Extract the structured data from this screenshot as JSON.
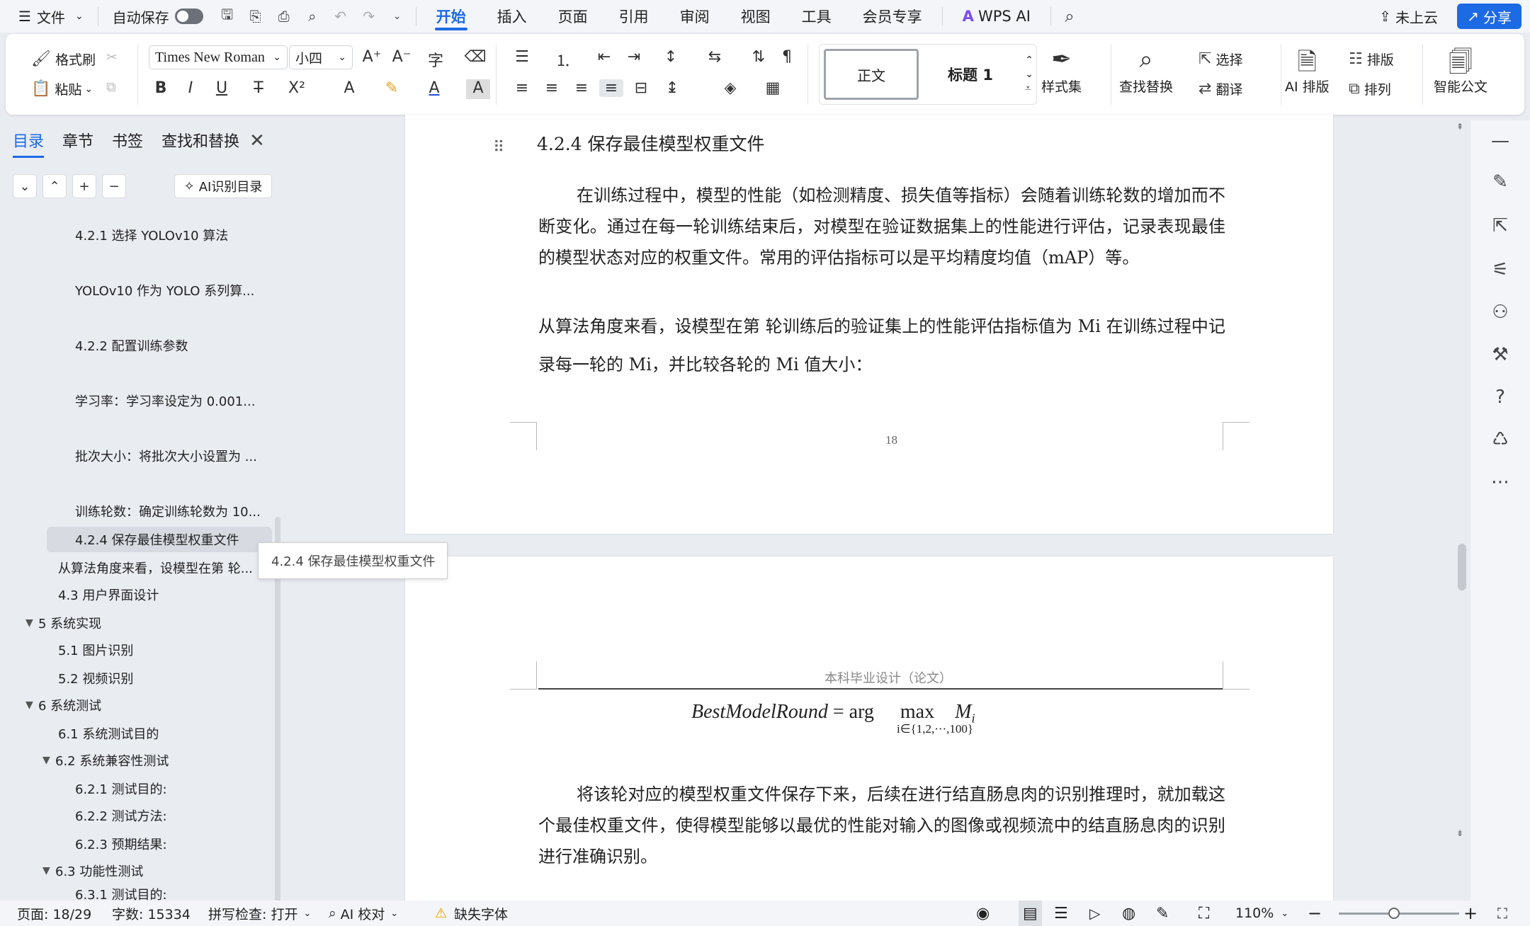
{
  "menubar": {
    "file": "文件",
    "autosave": "自动保存",
    "tabs": [
      "开始",
      "插入",
      "页面",
      "引用",
      "审阅",
      "视图",
      "工具",
      "会员专享"
    ],
    "wps_ai": "WPS AI",
    "cloud": "未上云",
    "share": "分享"
  },
  "ribbon": {
    "format_painter": "格式刷",
    "paste": "粘贴",
    "font_name": "Times New Roman",
    "font_size": "小四",
    "style_normal": "正文",
    "style_heading1": "标题 1",
    "style_set": "样式集",
    "find_replace": "查找替换",
    "select": "选择",
    "translate": "翻译",
    "ai_layout": "AI 排版",
    "layout": "排版",
    "arrange": "排列",
    "smart_doc": "智能公文"
  },
  "nav": {
    "tabs": [
      "目录",
      "章节",
      "书签",
      "查找和替换"
    ],
    "ai_toc": "AI识别目录",
    "items": [
      {
        "label": "4.2.1  选择  YOLOv10  算法",
        "level": 3
      },
      {
        "label": "YOLOv10  作为  YOLO  系列算...",
        "level": 3
      },
      {
        "label": "4.2.2  配置训练参数",
        "level": 3
      },
      {
        "label": "学习率：学习率设定为  0.001...",
        "level": 3
      },
      {
        "label": "批次大小：将批次大小设置为  ...",
        "level": 3
      },
      {
        "label": "训练轮数：确定训练轮数为  10...",
        "level": 3
      },
      {
        "label": "4.2.4  保存最佳模型权重文件",
        "level": 3
      },
      {
        "label": "从算法角度来看，设模型在第  轮...",
        "level": 2
      },
      {
        "label": "4.3 用户界面设计",
        "level": 2
      },
      {
        "label": "5 系统实现",
        "level": 1
      },
      {
        "label": "5.1  图片识别",
        "level": 2
      },
      {
        "label": "5.2  视频识别",
        "level": 2
      },
      {
        "label": "6  系统测试",
        "level": 1
      },
      {
        "label": "6.1  系统测试目的",
        "level": 2
      },
      {
        "label": "6.2  系统兼容性测试",
        "level": 2
      },
      {
        "label": "6.2.1 测试目的:",
        "level": 3
      },
      {
        "label": "6.2.2 测试方法:",
        "level": 3
      },
      {
        "label": "6.2.3 预期结果:",
        "level": 3
      },
      {
        "label": "6.3  功能性测试",
        "level": 2
      },
      {
        "label": "6.3.1 测试目的:",
        "level": 3
      }
    ],
    "tooltip": "4.2.4 保存最佳模型权重文件"
  },
  "document": {
    "heading": "4.2.4  保存最佳模型权重文件",
    "para1": "在训练过程中，模型的性能（如检测精度、损失值等指标）会随着训练轮数的增加而不断变化。通过在每一轮训练结束后，对模型在验证数据集上的性能进行评估，记录表现最佳的模型状态对应的权重文件。常用的评估指标可以是平均精度均值（mAP）等。",
    "para2": "从算法角度来看，设模型在第  轮训练后的验证集上的性能评估指标值为 Mi 在训练过程中记录每一轮的  Mi，并比较各轮的 Mi 值大小：",
    "page_number": "18",
    "page_header": "本科毕业设计（论文）",
    "formula_lhs": "BestModelRound",
    "formula_eq": "= arg",
    "formula_max": "max",
    "formula_var": "M",
    "formula_var_sub": "i",
    "formula_sub": "i∈{1,2,···,100}",
    "para3": "将该轮对应的模型权重文件保存下来，后续在进行结直肠息肉的识别推理时，就加载这个最佳权重文件，使得模型能够以最优的性能对输入的图像或视频流中的结直肠息肉的识别进行准确识别。"
  },
  "status": {
    "page": "页面: 18/29",
    "words": "字数: 15334",
    "spell": "拼写检查: 打开",
    "ai_check": "AI 校对",
    "missing_font": "缺失字体",
    "zoom": "110%"
  }
}
